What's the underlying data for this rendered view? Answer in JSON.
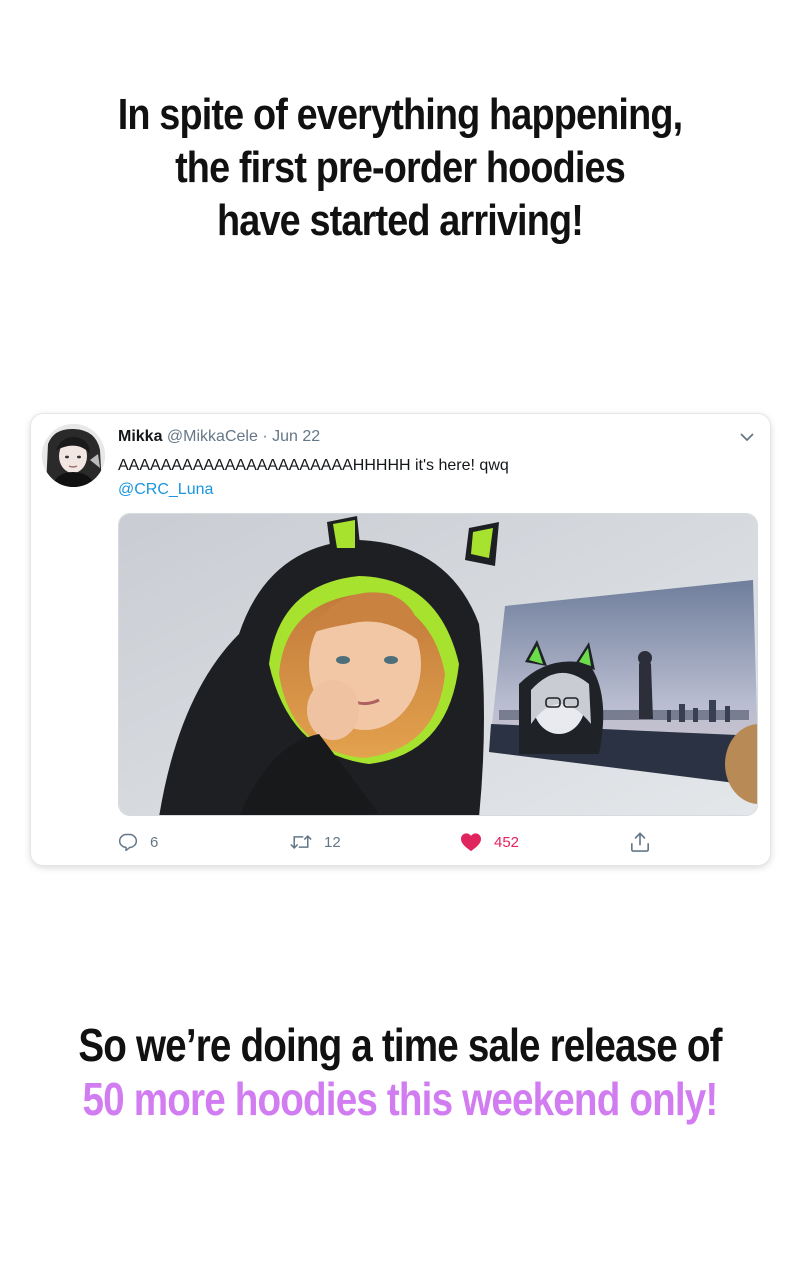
{
  "theme": {
    "accent": "#D27CF2",
    "link": "#1B95E0",
    "like": "#E0245E"
  },
  "headline_top": {
    "lines": [
      "In spite of everything happening,",
      "the first pre-order hoodies",
      "have started arriving!"
    ]
  },
  "tweet": {
    "author_name": "Mikka",
    "handle": "@MikkaCele",
    "separator": "·",
    "date": "Jun 22",
    "text": "AAAAAAAAAAAAAAAAAAAAAAHHHHH it's here! qwq",
    "mention": "@CRC_Luna",
    "icons": {
      "more": "chevron-down-icon",
      "reply": "speech-bubble-icon",
      "retweet": "retweet-icon",
      "like": "heart-icon",
      "share": "share-icon"
    },
    "stats": {
      "replies": "6",
      "retweets": "12",
      "likes": "452"
    },
    "liked": true
  },
  "headline_bottom": {
    "line1": "So we’re doing a time sale release of",
    "line2": "50 more hoodies this weekend only!"
  }
}
